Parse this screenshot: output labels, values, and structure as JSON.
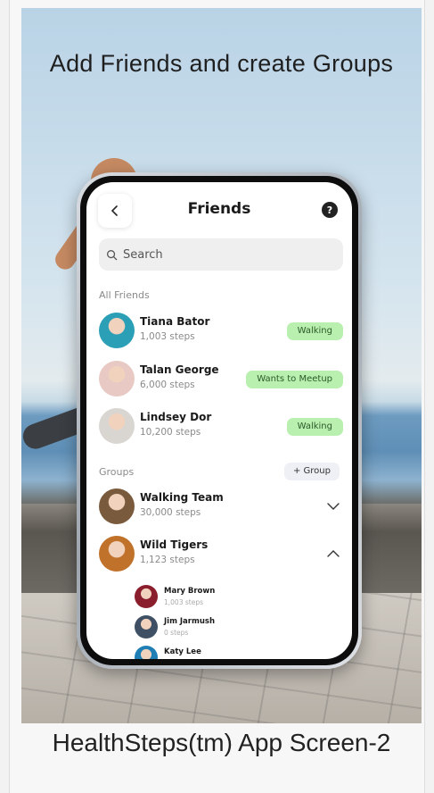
{
  "headline": "Add Friends and create Groups",
  "caption": "HealthSteps(tm) App Screen-2",
  "app": {
    "title": "Friends",
    "help_icon": "?",
    "search_placeholder": "Search",
    "all_friends_label": "All Friends",
    "groups_label": "Groups",
    "add_group_label": "+ Group",
    "friends": [
      {
        "name": "Tiana Bator",
        "steps": "1,003 steps",
        "status": "Walking",
        "avatar_color": "#2a9fb6"
      },
      {
        "name": "Talan George",
        "steps": "6,000 steps",
        "status": "Wants to Meetup",
        "avatar_color": "#e8c9c4"
      },
      {
        "name": "Lindsey Dor",
        "steps": "10,200 steps",
        "status": "Walking",
        "avatar_color": "#d9d6d2"
      }
    ],
    "groups": [
      {
        "name": "Walking Team",
        "steps": "30,000 steps",
        "expanded": false,
        "avatar_color": "#7a5a3c"
      },
      {
        "name": "Wild Tigers",
        "steps": "1,123 steps",
        "expanded": true,
        "avatar_color": "#c0712a"
      }
    ],
    "group_members": [
      {
        "name": "Mary Brown",
        "steps": "1,003 steps",
        "avatar_color": "#8b1e2d"
      },
      {
        "name": "Jim Jarmush",
        "steps": "0 steps",
        "avatar_color": "#3f5064"
      },
      {
        "name": "Katy Lee",
        "steps": "",
        "avatar_color": "#1f7fb5"
      }
    ],
    "colors": {
      "status_badge": "#b9f0b0",
      "accent_text": "#2b5a28"
    }
  }
}
